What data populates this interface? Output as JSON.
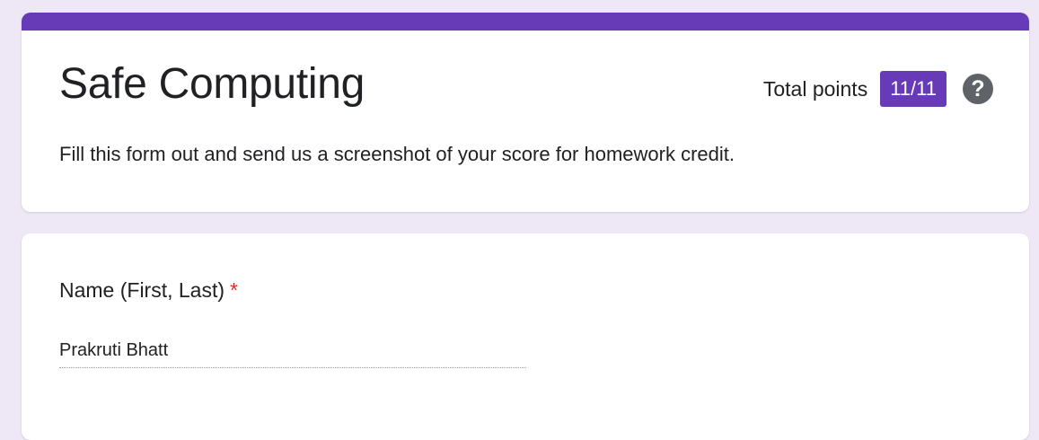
{
  "form": {
    "title": "Safe Computing",
    "description": "Fill this form out and send us a screenshot of your score for homework credit.",
    "total_points_label": "Total points",
    "score": "11/11",
    "help_icon": "help-circle-icon",
    "help_glyph": "?"
  },
  "question": {
    "label": "Name (First, Last)",
    "required_marker": "*",
    "answer": "Prakruti Bhatt"
  },
  "colors": {
    "accent": "#673ab7",
    "background": "#ede7f6",
    "required": "#d93025"
  }
}
